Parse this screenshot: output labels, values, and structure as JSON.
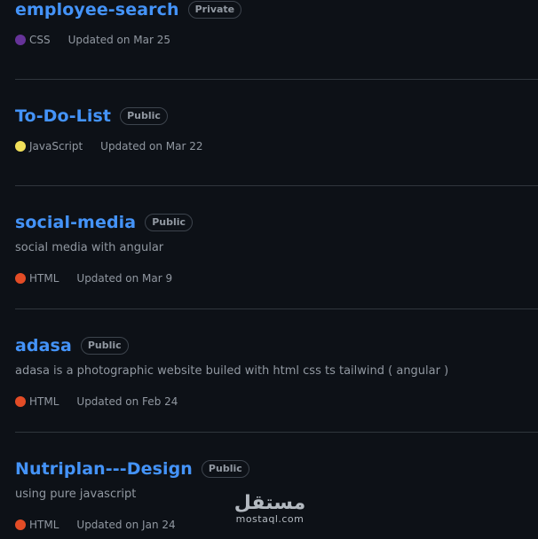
{
  "repos": [
    {
      "name": "employee-search",
      "visibility": "Private",
      "description": "",
      "language": "CSS",
      "language_color": "#663399",
      "updated": "Updated on Mar 25"
    },
    {
      "name": "To-Do-List",
      "visibility": "Public",
      "description": "",
      "language": "JavaScript",
      "language_color": "#f1e05a",
      "updated": "Updated on Mar 22"
    },
    {
      "name": "social-media",
      "visibility": "Public",
      "description": "social media with angular",
      "language": "HTML",
      "language_color": "#e34c26",
      "updated": "Updated on Mar 9"
    },
    {
      "name": "adasa",
      "visibility": "Public",
      "description": "adasa is a photographic website builed with html css ts tailwind ( angular )",
      "language": "HTML",
      "language_color": "#e34c26",
      "updated": "Updated on Feb 24"
    },
    {
      "name": "Nutriplan---Design",
      "visibility": "Public",
      "description": "using pure javascript",
      "language": "HTML",
      "language_color": "#e34c26",
      "updated": "Updated on Jan 24"
    }
  ],
  "watermark": {
    "arabic": "مستقل",
    "latin": "mostaql.com"
  }
}
